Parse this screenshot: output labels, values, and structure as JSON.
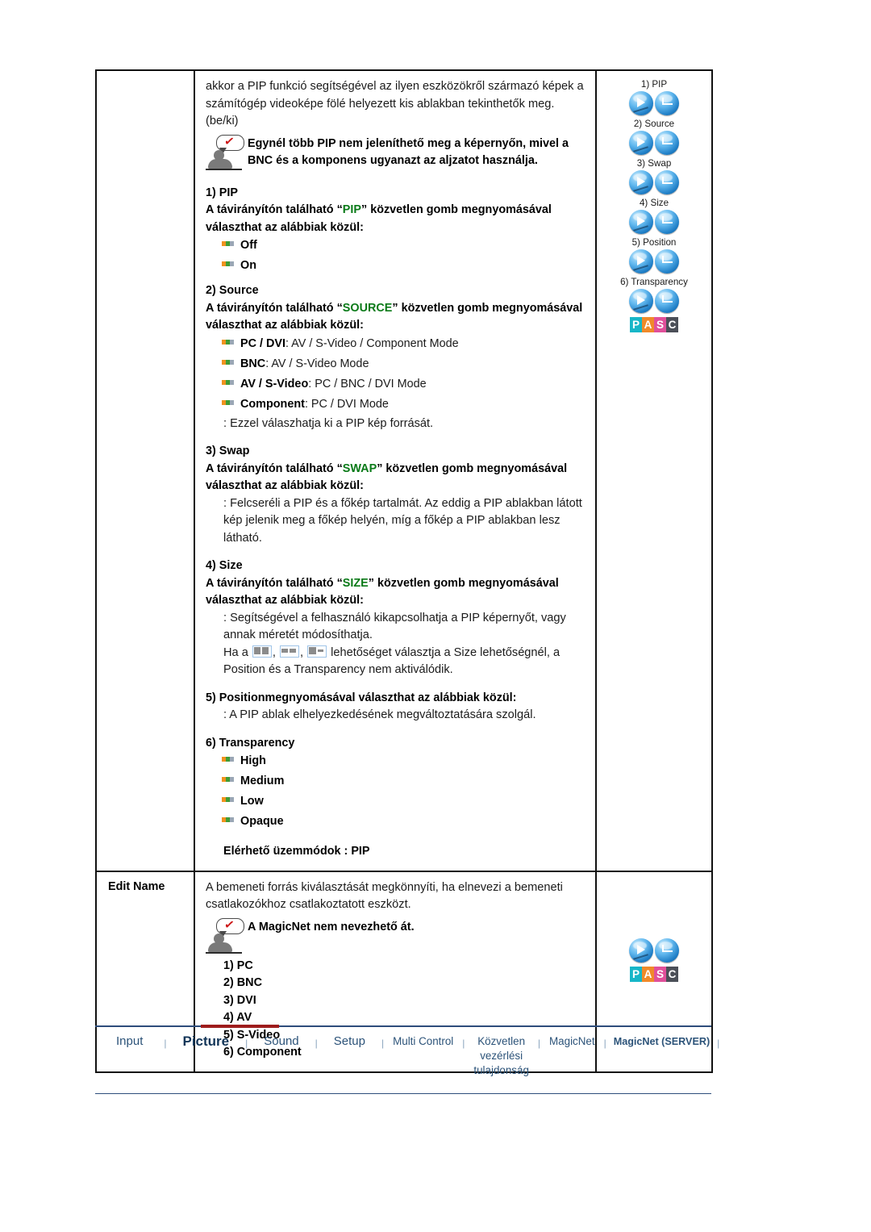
{
  "document": {
    "intro_paragraph": "akkor a PIP funkció segítségével az ilyen eszközökről származó képek a számítógép videoképe fölé helyezett kis ablakban tekinthetők meg. (be/ki)",
    "note_1": "Egynél több PIP nem jeleníthető meg a képernyőn, mivel a BNC és a komponens ugyanazt az aljzatot használja.",
    "section_pip": {
      "heading": "1) PIP",
      "desc_before": "A távirányítón található “",
      "desc_key": "PIP",
      "desc_after": "” közvetlen gomb megnyomásával választhat az alábbiak közül:",
      "options": [
        "Off",
        "On"
      ]
    },
    "section_source": {
      "heading": "2) Source",
      "desc_before": "A távirányítón található “",
      "desc_key": "SOURCE",
      "desc_after": "” közvetlen gomb megnyomásával választhat az alábbiak közül:",
      "options": [
        {
          "label": "PC / DVI",
          "value": " : AV / S-Video / Component Mode"
        },
        {
          "label": "BNC",
          "value": " : AV / S-Video Mode"
        },
        {
          "label": "AV / S-Video",
          "value": " : PC / BNC / DVI Mode"
        },
        {
          "label": "Component",
          "value": " : PC / DVI Mode"
        }
      ],
      "footnote": ": Ezzel válaszhatja ki a PIP kép forrását."
    },
    "section_swap": {
      "heading": "3) Swap",
      "desc_before": "A távirányítón található “",
      "desc_key": "SWAP",
      "desc_after": "” közvetlen gomb megnyomásával választhat az alábbiak közül:",
      "footnote": ": Felcseréli a PIP és a főkép tartalmát. Az eddig a PIP ablakban látott kép jelenik meg a főkép helyén, míg a főkép a PIP ablakban lesz látható."
    },
    "section_size": {
      "heading": "4) Size",
      "desc_before": "A távirányítón található “",
      "desc_key": "SIZE",
      "desc_after": "” közvetlen gomb megnyomásával választhat az alábbiak közül:",
      "footnote_1": ": Segítségével a felhasználó kikapcsolhatja a PIP képernyőt, vagy annak méretét módosíthatja.",
      "footnote_2_pre": "Ha a ",
      "footnote_2_post": " lehetőséget választja a Size lehetőségnél, a Position és a Transparency nem aktiválódik."
    },
    "section_position": {
      "heading": "5) Positionmegnyomásával választhat az alábbiak közül:",
      "footnote": ": A PIP ablak elhelyezkedésének megváltoztatására szolgál."
    },
    "section_transparency": {
      "heading": "6) Transparency",
      "options": [
        "High",
        "Medium",
        "Low",
        "Opaque"
      ]
    },
    "available_modes": "Elérhető üzemmódok : PIP",
    "edit_name": {
      "row_label": "Edit Name",
      "paragraph": "A bemeneti forrás kiválasztását megkönnyíti, ha elnevezi a bemeneti csatlakozókhoz csatlakoztatott eszközt.",
      "note": "A MagicNet nem nevezhető át.",
      "items": [
        "1) PC",
        "2) BNC",
        "3) DVI",
        "4) AV",
        "5) S-Video",
        "6) Component"
      ]
    }
  },
  "figure_pip": {
    "captions": [
      "1) PIP",
      "2) Source",
      "3) Swap",
      "4) Size",
      "5) Position",
      "6) Transparency"
    ],
    "logo": [
      "P",
      "A",
      "S",
      "C"
    ]
  },
  "figure_editname": {
    "logo": [
      "P",
      "A",
      "S",
      "C"
    ]
  },
  "footer": {
    "items": [
      {
        "label": "Input",
        "style": "normal"
      },
      {
        "label": "Picture",
        "style": "active"
      },
      {
        "label": "Sound",
        "style": "normal"
      },
      {
        "label": "Setup",
        "style": "normal"
      },
      {
        "label": "Multi Control",
        "style": "small"
      },
      {
        "label": "Közvetlen vezérlési tulajdonság",
        "style": "small"
      },
      {
        "label": "MagicNet",
        "style": "small"
      },
      {
        "label": "MagicNet (SERVER)",
        "style": "smaller"
      }
    ],
    "separator": "|"
  },
  "colors": {
    "accent_green": "#0a7a18",
    "footer_blue": "#2c5379",
    "active_red": "#9e1c1c",
    "bullet_orange": "#f0921e",
    "bullet_green": "#3f9c35",
    "bullet_gray": "#9aa7b5"
  }
}
